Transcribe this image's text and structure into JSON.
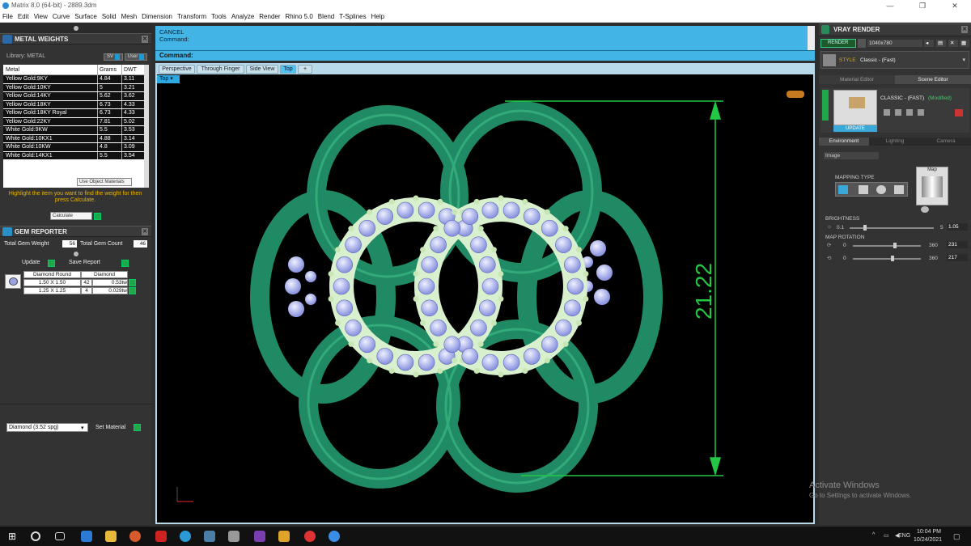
{
  "window": {
    "title": "Matrix 8.0 (64-bit) - 2889.3dm",
    "minimize": "—",
    "restore": "❐",
    "close": "✕"
  },
  "menu": [
    "File",
    "Edit",
    "View",
    "Curve",
    "Surface",
    "Solid",
    "Mesh",
    "Dimension",
    "Transform",
    "Tools",
    "Analyze",
    "Render",
    "Rhino 5.0",
    "Blend",
    "T-Splines",
    "Help"
  ],
  "metal_weights": {
    "title": "METAL WEIGHTS",
    "library_label": "Library: METAL",
    "sv_label": "SV",
    "user_label": "User",
    "columns": [
      "Metal",
      "Grams",
      "DWT"
    ],
    "rows": [
      [
        "Yellow Gold:9KY",
        "4.84",
        "3.11"
      ],
      [
        "Yellow Gold:10KY",
        "5",
        "3.21"
      ],
      [
        "Yellow Gold:14KY",
        "5.62",
        "3.62"
      ],
      [
        "Yellow Gold:18KY",
        "6.73",
        "4.33"
      ],
      [
        "Yellow Gold:18KY Royal",
        "6.73",
        "4.33"
      ],
      [
        "Yellow Gold:22KY",
        "7.81",
        "5.02"
      ],
      [
        "White Gold:9KW",
        "5.5",
        "3.53"
      ],
      [
        "White Gold:10KX1",
        "4.88",
        "3.14"
      ],
      [
        "White Gold:10KW",
        "4.8",
        "3.09"
      ],
      [
        "White Gold:14KX1",
        "5.5",
        "3.54"
      ]
    ],
    "use_object_materials": "Use Object Materials",
    "hint": "Highlight the item you want to find the weight for then press Calculate.",
    "calculate": "Calculate"
  },
  "gem_reporter": {
    "title": "GEM REPORTER",
    "total_weight_label": "Total Gem Weight",
    "total_weight": "56",
    "total_count_label": "Total Gem Count",
    "total_count": "46",
    "update": "Update",
    "save_report": "Save Report",
    "columns": [
      "Diamond Round",
      "Diamond"
    ],
    "rows": [
      {
        "size": "1.50 X 1.50",
        "count": "42",
        "weight": "0.53tw"
      },
      {
        "size": "1.25 X 1.25",
        "count": "4",
        "weight": "0.029tw"
      }
    ],
    "material_select": "Diamond   (3.52 spg)",
    "set_material": "Set Material"
  },
  "command": {
    "line1": "CANCEL",
    "line2": "Command:",
    "prompt": "Command:"
  },
  "viewport": {
    "tabs": [
      "Perspective",
      "Through Finger",
      "Side View",
      "Top",
      "+"
    ],
    "active_tab": "Top",
    "view_dropdown": "Top",
    "dimension": "21.22"
  },
  "vray": {
    "title": "VRAY RENDER",
    "render_label": "RENDER",
    "resolution": "1040x780",
    "style_label": "STYLE",
    "style_value": "Classic - (Fast)",
    "tabs": [
      "Material Editor",
      "Scene Editor"
    ],
    "preset_name": "CLASSIC - (FAST)",
    "preset_state": "(Modified)",
    "update": "UPDATE",
    "subtabs": [
      "Environment",
      "Lighting",
      "Camera"
    ],
    "env_type": "Image",
    "mapping_type_label": "MAPPING TYPE",
    "map_label": "Map",
    "brightness_label": "BRIGHTNESS",
    "brightness_min": "0.1",
    "brightness_max": "5",
    "brightness_value": "1.05",
    "map_rotation_label": "MAP ROTATION",
    "rot1_min": "0",
    "rot1_max": "360",
    "rot1_value": "231",
    "rot2_min": "0",
    "rot2_max": "360",
    "rot2_value": "217"
  },
  "watermark": {
    "line1": "Activate Windows",
    "line2": "Go to Settings to activate Windows."
  },
  "taskbar": {
    "lang": "ENG",
    "time": "10:04 PM",
    "date": "10/24/2021"
  },
  "colors": {
    "ring_green": "#1f8a63",
    "dim_green": "#22c844",
    "cmd_blue": "#42b4e6",
    "gem": "#b7bdf2"
  }
}
